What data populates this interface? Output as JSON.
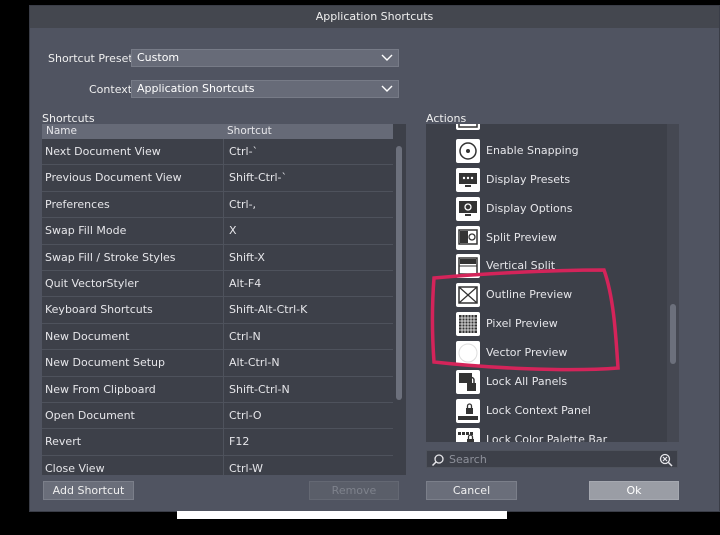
{
  "dialog": {
    "title": "Application Shortcuts"
  },
  "presets": {
    "label": "Shortcut Presets",
    "value": "Custom"
  },
  "context": {
    "label": "Context",
    "value": "Application Shortcuts"
  },
  "shortcuts": {
    "section_label": "Shortcuts",
    "col_name": "Name",
    "col_shortcut": "Shortcut",
    "rows": [
      {
        "name": "Next Document View",
        "shortcut": "Ctrl-`"
      },
      {
        "name": "Previous Document View",
        "shortcut": "Shift-Ctrl-`"
      },
      {
        "name": "Preferences",
        "shortcut": "Ctrl-,"
      },
      {
        "name": "Swap Fill Mode",
        "shortcut": "X"
      },
      {
        "name": "Swap Fill / Stroke Styles",
        "shortcut": "Shift-X"
      },
      {
        "name": "Quit VectorStyler",
        "shortcut": "Alt-F4"
      },
      {
        "name": "Keyboard Shortcuts",
        "shortcut": "Shift-Alt-Ctrl-K"
      },
      {
        "name": "New Document",
        "shortcut": "Ctrl-N"
      },
      {
        "name": "New Document Setup",
        "shortcut": "Alt-Ctrl-N"
      },
      {
        "name": "New From Clipboard",
        "shortcut": "Shift-Ctrl-N"
      },
      {
        "name": "Open Document",
        "shortcut": "Ctrl-O"
      },
      {
        "name": "Revert",
        "shortcut": "F12"
      },
      {
        "name": "Close View",
        "shortcut": "Ctrl-W"
      }
    ]
  },
  "actions": {
    "section_label": "Actions",
    "items": [
      {
        "label": "Enable Snapping",
        "icon": "enable-snapping-icon"
      },
      {
        "label": "Display Presets",
        "icon": "display-presets-icon"
      },
      {
        "label": "Display Options",
        "icon": "display-options-icon"
      },
      {
        "label": "Split Preview",
        "icon": "split-preview-icon"
      },
      {
        "label": "Vertical Split",
        "icon": "vertical-split-icon"
      },
      {
        "label": "Outline Preview",
        "icon": "outline-preview-icon"
      },
      {
        "label": "Pixel Preview",
        "icon": "pixel-preview-icon"
      },
      {
        "label": "Vector Preview",
        "icon": "vector-preview-icon"
      },
      {
        "label": "Lock All Panels",
        "icon": "lock-all-panels-icon"
      },
      {
        "label": "Lock Context Panel",
        "icon": "lock-context-panel-icon"
      },
      {
        "label": "Lock Color Palette Bar",
        "icon": "lock-color-palette-bar-icon"
      }
    ]
  },
  "search": {
    "placeholder": "Search"
  },
  "buttons": {
    "add_shortcut": "Add Shortcut",
    "remove": "Remove",
    "cancel": "Cancel",
    "ok": "Ok"
  },
  "colors": {
    "annotation": "#d4245a",
    "panel": "#505461",
    "list_bg": "#3d4049"
  }
}
